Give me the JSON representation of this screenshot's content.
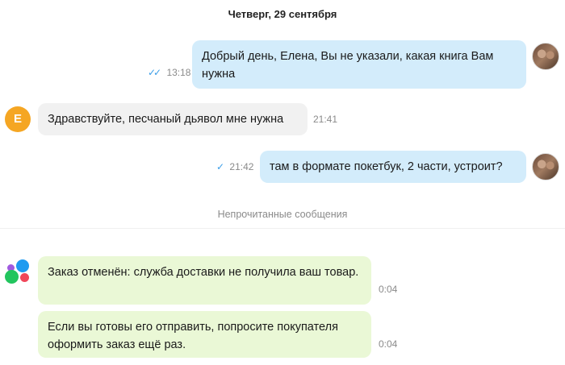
{
  "chat": {
    "date_header": "Четверг, 29 сентября",
    "unread_divider": "Непрочитанные сообщения",
    "messages": [
      {
        "text": "Добрый день, Елена, Вы не указали, какая книга Вам нужна",
        "time": "13:18"
      },
      {
        "avatar_letter": "E",
        "text": "Здравствуйте, песчаный дьявол мне нужна",
        "time": "21:41"
      },
      {
        "text": "там в формате покетбук, 2 части, устроит?",
        "time": "21:42"
      },
      {
        "text": "Заказ отменён: служба доставки не получила ваш товар.",
        "time": "0:04"
      },
      {
        "text": "Если вы готовы его отправить, попросите покупателя оформить заказ ещё раз.",
        "time": "0:04"
      }
    ]
  },
  "colors": {
    "outgoing_bubble": "#d3ecfb",
    "incoming_bubble": "#f1f1f1",
    "system_bubble": "#eaf8d6",
    "check_marks": "#3b9ee8"
  }
}
